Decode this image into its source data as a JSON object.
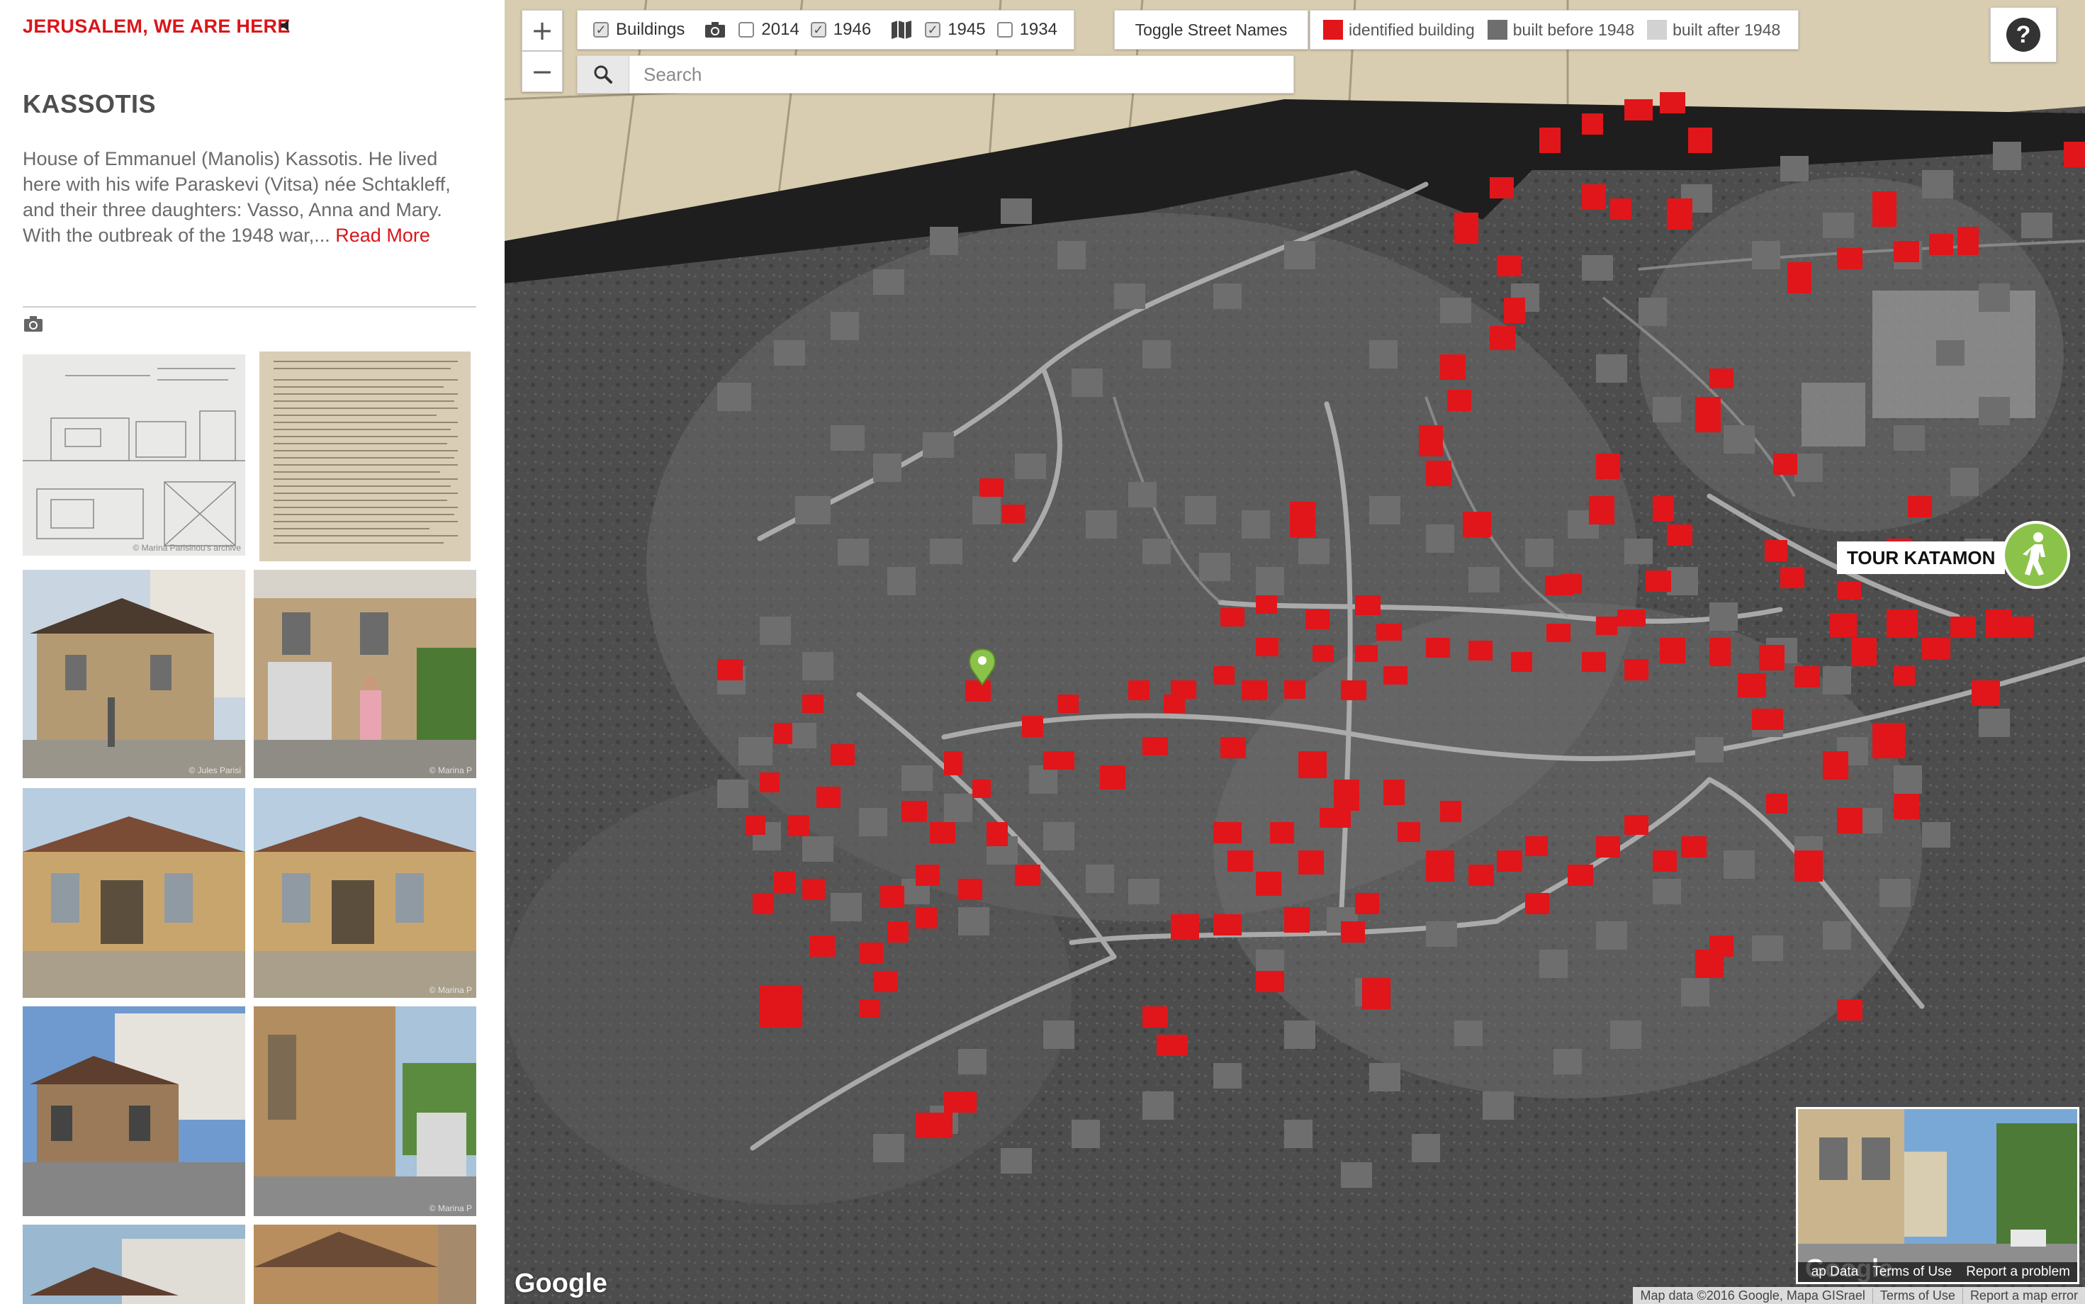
{
  "sidebar": {
    "site_title": "JERUSALEM, WE ARE HERE",
    "place_title": "KASSOTIS",
    "description": "House of Emmanuel (Manolis) Kassotis. He lived here with his wife Paraskevi (Vitsa) née Schtakleff, and their three daughters: Vasso, Anna and Mary. With the outbreak of the 1948 war,...",
    "read_more": "Read More",
    "gallery": [
      {
        "label": "© Marina Parisinou's archive",
        "kind": "blueprint"
      },
      {
        "label": "",
        "kind": "document"
      },
      {
        "label": "© Jules Parisi",
        "kind": "house-front"
      },
      {
        "label": "© Marina P",
        "kind": "house-gate-woman"
      },
      {
        "label": "",
        "kind": "house-sunlit"
      },
      {
        "label": "© Marina P",
        "kind": "house-sunlit-2"
      },
      {
        "label": "",
        "kind": "house-street"
      },
      {
        "label": "© Marina P",
        "kind": "house-wall"
      },
      {
        "label": "",
        "kind": "house-partial"
      },
      {
        "label": "",
        "kind": "house-partial-2"
      }
    ]
  },
  "map": {
    "zoom_in": "+",
    "zoom_out": "−",
    "layers": {
      "buildings_label": "Buildings",
      "buildings_checked": true,
      "photo_icon": "camera-icon",
      "years_photo": [
        {
          "label": "2014",
          "checked": false
        },
        {
          "label": "1946",
          "checked": true
        }
      ],
      "map_icon": "map-icon",
      "years_map": [
        {
          "label": "1945",
          "checked": true
        },
        {
          "label": "1934",
          "checked": false
        }
      ]
    },
    "toggle_street_names": "Toggle Street Names",
    "legend": [
      {
        "label": "identified building",
        "color": "#e0161b"
      },
      {
        "label": "built before 1948",
        "color": "#6e6e6e"
      },
      {
        "label": "built after 1948",
        "color": "#d2d2d2"
      }
    ],
    "search_placeholder": "Search",
    "help": "?",
    "tour_label": "TOUR KATAMON",
    "streetview": {
      "google": "Google",
      "map_data": "ap Data",
      "terms": "Terms of Use",
      "report": "Report a problem"
    },
    "google_logo": "Google",
    "attribution": {
      "map_data": "Map data ©2016 Google, Mapa GISrael",
      "terms": "Terms of Use",
      "report": "Report a map error"
    }
  }
}
